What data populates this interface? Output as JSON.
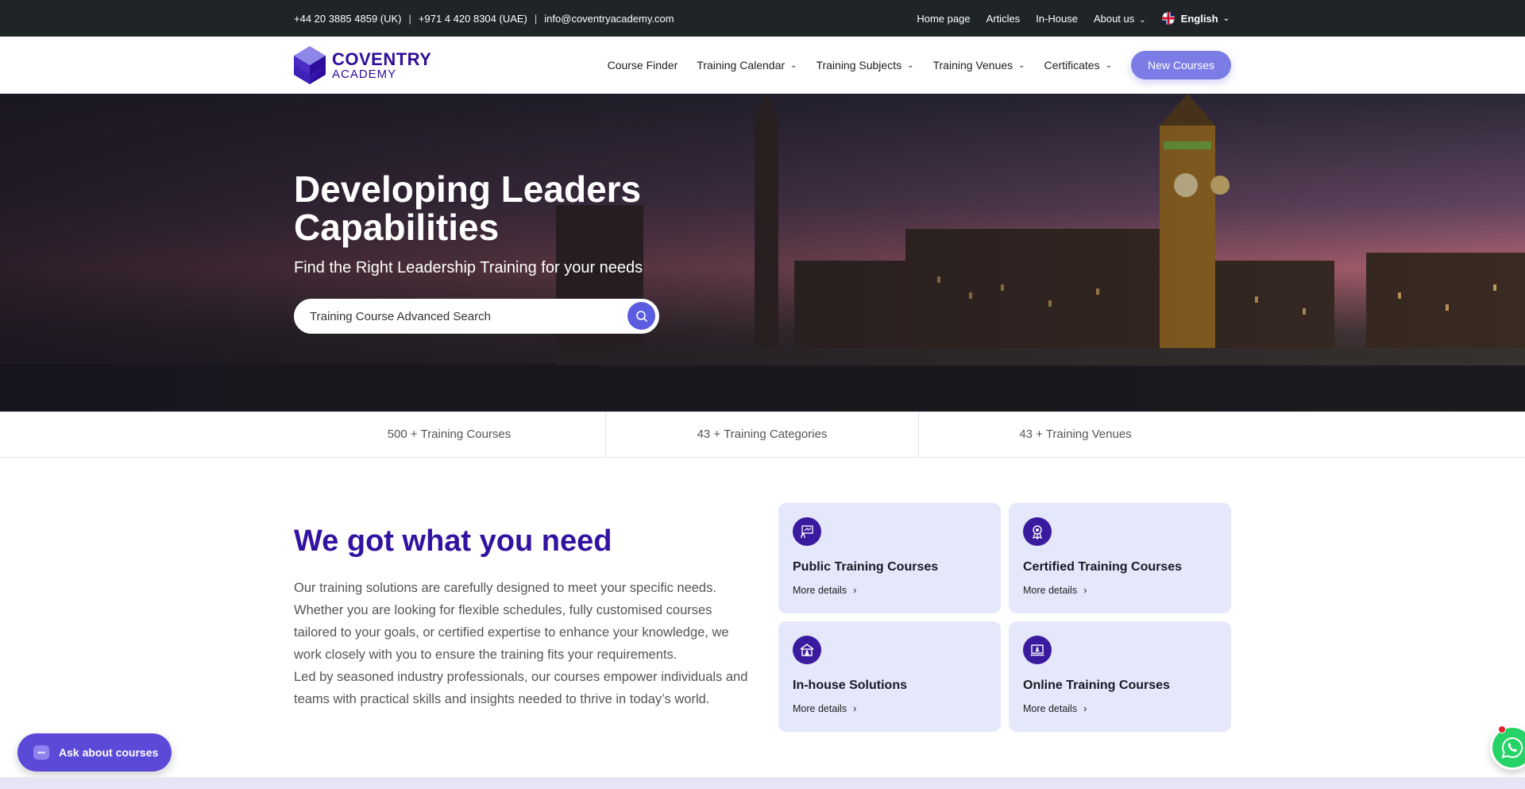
{
  "topbar": {
    "phone_uk": "+44 20 3885 4859 (UK)",
    "phone_uae": "+971 4 420 8304 (UAE)",
    "separator": "|",
    "email": "info@coventryacademy.com",
    "links": [
      "Home page",
      "Articles",
      "In-House",
      "About us"
    ],
    "language": "English"
  },
  "logo": {
    "line1": "COVENTRY",
    "line2": "ACADEMY"
  },
  "nav": {
    "items": [
      "Course Finder",
      "Training Calendar",
      "Training Subjects",
      "Training Venues",
      "Certificates"
    ],
    "cta": "New Courses"
  },
  "hero": {
    "title": "Developing Leaders Capabilities",
    "subtitle": "Find the Right Leadership Training for your needs",
    "search_placeholder": "Training Course Advanced Search"
  },
  "stats": [
    "500 + Training Courses",
    "43 + Training Categories",
    "43 + Training Venues"
  ],
  "intro": {
    "title": "We got what you need",
    "paragraph1": "Our training solutions are carefully designed to meet your specific needs. Whether you are looking for flexible schedules, fully customised courses tailored to your goals, or certified expertise to enhance your knowledge, we work closely with you to ensure the training fits your requirements.",
    "paragraph2": "Led by seasoned industry professionals, our courses empower individuals and teams with practical skills and insights needed to thrive in today’s world."
  },
  "cards": [
    {
      "title": "Public Training Courses",
      "more": "More details",
      "icon": "presentation-icon"
    },
    {
      "title": "Certified Training Courses",
      "more": "More details",
      "icon": "certificate-badge-icon"
    },
    {
      "title": "In-house Solutions",
      "more": "More details",
      "icon": "building-icon"
    },
    {
      "title": "Online Training Courses",
      "more": "More details",
      "icon": "laptop-icon"
    }
  ],
  "floating": {
    "ask_label": "Ask about courses"
  },
  "colors": {
    "brand": "#3212a0",
    "accent": "#7b7ce6",
    "topbar": "#1f2427",
    "card": "#e5e7fb"
  }
}
